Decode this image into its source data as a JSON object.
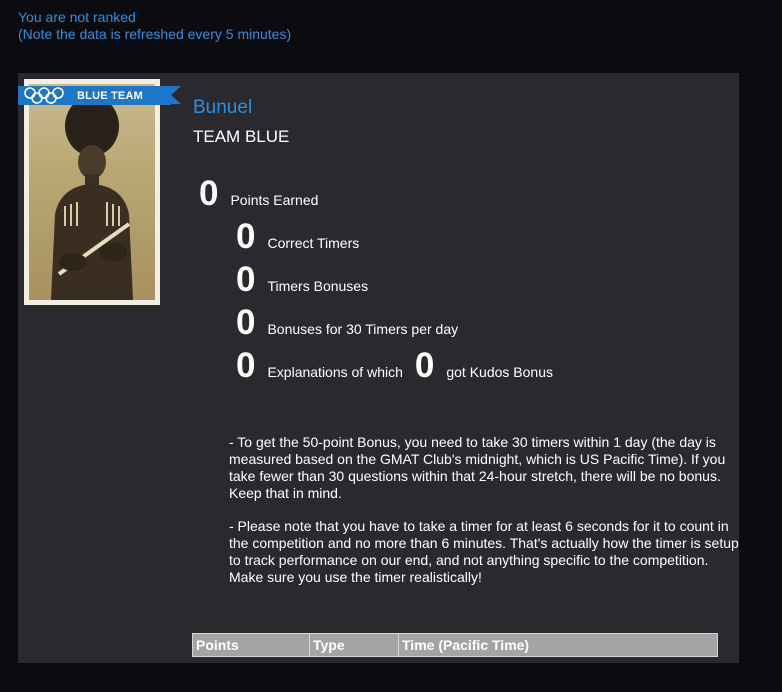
{
  "status": {
    "rank_text": "You are not ranked",
    "refresh_note": "(Note the data is refreshed every 5 minutes)"
  },
  "profile": {
    "badge_label": "BLUE TEAM",
    "username": "Bunuel",
    "team": "TEAM BLUE",
    "accent_color": "#1d77c9",
    "link_color": "#2d8ee0"
  },
  "stats": {
    "points_earned": {
      "value": "0",
      "label": "Points Earned"
    },
    "correct_timers": {
      "value": "0",
      "label": "Correct Timers"
    },
    "timers_bonuses": {
      "value": "0",
      "label": "Timers Bonuses"
    },
    "bonuses_30": {
      "value": "0",
      "label": "Bonuses for 30 Timers per day"
    },
    "explanations": {
      "value": "0",
      "label": "Explanations of which"
    },
    "kudos": {
      "value": "0",
      "label": "got Kudos Bonus"
    }
  },
  "notes": [
    "- To get the 50-point Bonus, you need to take 30 timers within 1 day (the day is measured based on the GMAT Club's midnight, which is US Pacific Time). If you take fewer than 30 questions within that 24-hour stretch, there will be no bonus. Keep that in mind.",
    "- Please note that you have to take a timer for at least 6 seconds for it to count in the competition and no more than 6 minutes. That's actually how the timer is setup to track performance on our end, and not anything specific to the competition. Make sure you use the timer realistically!"
  ],
  "table": {
    "headers": [
      "Points",
      "Type",
      "Time (Pacific Time)"
    ]
  }
}
